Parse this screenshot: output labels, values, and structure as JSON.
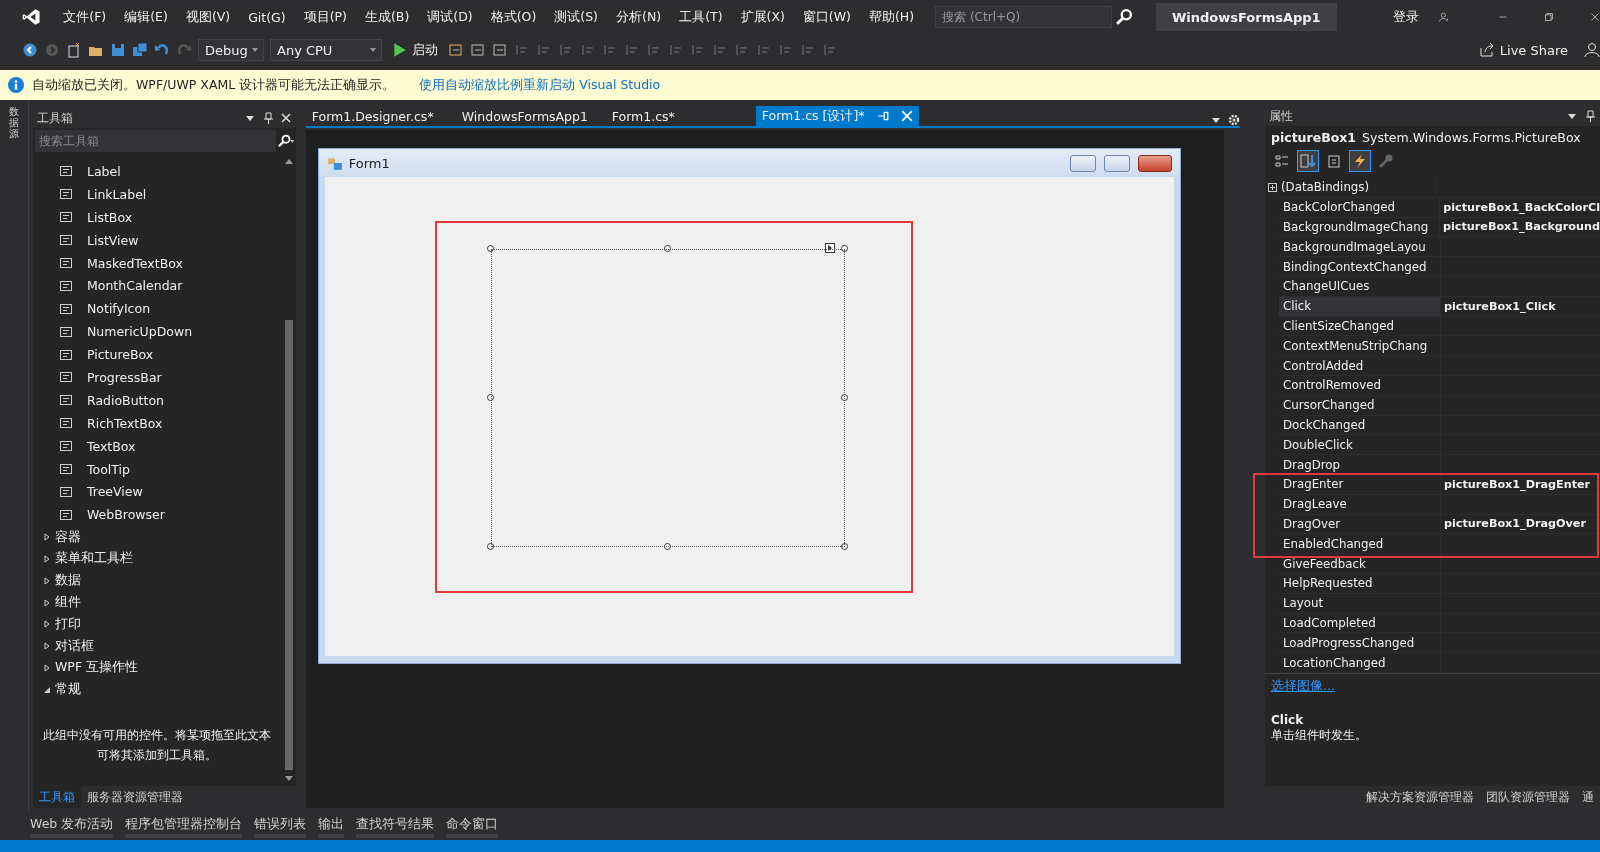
{
  "menu": [
    "文件(F)",
    "编辑(E)",
    "视图(V)",
    "Git(G)",
    "项目(P)",
    "生成(B)",
    "调试(D)",
    "格式(O)",
    "测试(S)",
    "分析(N)",
    "工具(T)",
    "扩展(X)",
    "窗口(W)",
    "帮助(H)"
  ],
  "search": {
    "placeholder": "搜索 (Ctrl+Q)"
  },
  "solution_title": "WindowsFormsApp1",
  "sign_in": "登录",
  "toolbar": {
    "configuration": "Debug",
    "platform": "Any CPU",
    "start": "启动",
    "live_share": "Live Share"
  },
  "infobar": {
    "message": "自动缩放已关闭。WPF/UWP XAML 设计器可能无法正确显示。",
    "link": "使用自动缩放比例重新启动 Visual Studio"
  },
  "side_strip": "数据源",
  "toolbox": {
    "title": "工具箱",
    "search_placeholder": "搜索工具箱",
    "items": [
      "Label",
      "LinkLabel",
      "ListBox",
      "ListView",
      "MaskedTextBox",
      "MonthCalendar",
      "NotifyIcon",
      "NumericUpDown",
      "PictureBox",
      "ProgressBar",
      "RadioButton",
      "RichTextBox",
      "TextBox",
      "ToolTip",
      "TreeView",
      "WebBrowser"
    ],
    "groups": [
      {
        "label": "容器",
        "expanded": false
      },
      {
        "label": "菜单和工具栏",
        "expanded": false
      },
      {
        "label": "数据",
        "expanded": false
      },
      {
        "label": "组件",
        "expanded": false
      },
      {
        "label": "打印",
        "expanded": false
      },
      {
        "label": "对话框",
        "expanded": false
      },
      {
        "label": "WPF 互操作性",
        "expanded": false
      },
      {
        "label": "常规",
        "expanded": true
      }
    ],
    "empty_message": "此组中没有可用的控件。将某项拖至此文本可将其添加到工具箱。",
    "tabs": [
      {
        "label": "工具箱",
        "selected": true
      },
      {
        "label": "服务器资源管理器",
        "selected": false
      }
    ]
  },
  "editor_tabs": [
    {
      "label": "Form1.Designer.cs*",
      "selected": false
    },
    {
      "label": "WindowsFormsApp1",
      "selected": false
    },
    {
      "label": "Form1.cs*",
      "selected": false
    },
    {
      "label": "Form1.cs [设计]*",
      "selected": true
    }
  ],
  "form": {
    "title": "Form1"
  },
  "properties": {
    "title": "属性",
    "object_name": "pictureBox1",
    "object_type": "System.Windows.Forms.PictureBox",
    "tools": [
      {
        "kind": "categorized",
        "selected": false
      },
      {
        "kind": "alphabetical",
        "selected": true
      },
      {
        "kind": "properties",
        "selected": false
      },
      {
        "kind": "events",
        "selected": true
      },
      {
        "kind": "pages",
        "selected": false
      }
    ],
    "data_bindings": {
      "label": "(DataBindings)",
      "expanded": false
    },
    "rows": [
      {
        "name": "BackColorChanged",
        "value": "pictureBox1_BackColorCl",
        "selected": false
      },
      {
        "name": "BackgroundImageChang",
        "value": "pictureBox1_Background",
        "selected": false
      },
      {
        "name": "BackgroundImageLayou",
        "selected": false
      },
      {
        "name": "BindingContextChanged",
        "selected": false
      },
      {
        "name": "ChangeUICues",
        "selected": false
      },
      {
        "name": "Click",
        "value": "pictureBox1_Click",
        "selected": true
      },
      {
        "name": "ClientSizeChanged",
        "selected": false
      },
      {
        "name": "ContextMenuStripChang",
        "selected": false
      },
      {
        "name": "ControlAdded",
        "selected": false
      },
      {
        "name": "ControlRemoved",
        "selected": false
      },
      {
        "name": "CursorChanged",
        "selected": false
      },
      {
        "name": "DockChanged",
        "selected": false
      },
      {
        "name": "DoubleClick",
        "selected": false
      },
      {
        "name": "DragDrop",
        "selected": false
      },
      {
        "name": "DragEnter",
        "value": "pictureBox1_DragEnter",
        "selected": false
      },
      {
        "name": "DragLeave",
        "selected": false
      },
      {
        "name": "DragOver",
        "value": "pictureBox1_DragOver",
        "selected": false
      },
      {
        "name": "EnabledChanged",
        "selected": false
      },
      {
        "name": "GiveFeedback",
        "selected": false
      },
      {
        "name": "HelpRequested",
        "selected": false
      },
      {
        "name": "Layout",
        "selected": false
      },
      {
        "name": "LoadCompleted",
        "selected": false
      },
      {
        "name": "LoadProgressChanged",
        "selected": false
      },
      {
        "name": "LocationChanged",
        "selected": false
      }
    ],
    "command_link": "选择图像...",
    "description": {
      "title": "Click",
      "text": "单击组件时发生。"
    },
    "tabs": [
      {
        "label": "解决方案资源管理器",
        "selected": false
      },
      {
        "label": "团队资源管理器",
        "selected": false
      },
      {
        "label": "通",
        "selected": false
      }
    ]
  },
  "bottom_tabs": [
    "Web 发布活动",
    "程序包管理器控制台",
    "错误列表",
    "输出",
    "查找符号结果",
    "命令窗口"
  ]
}
